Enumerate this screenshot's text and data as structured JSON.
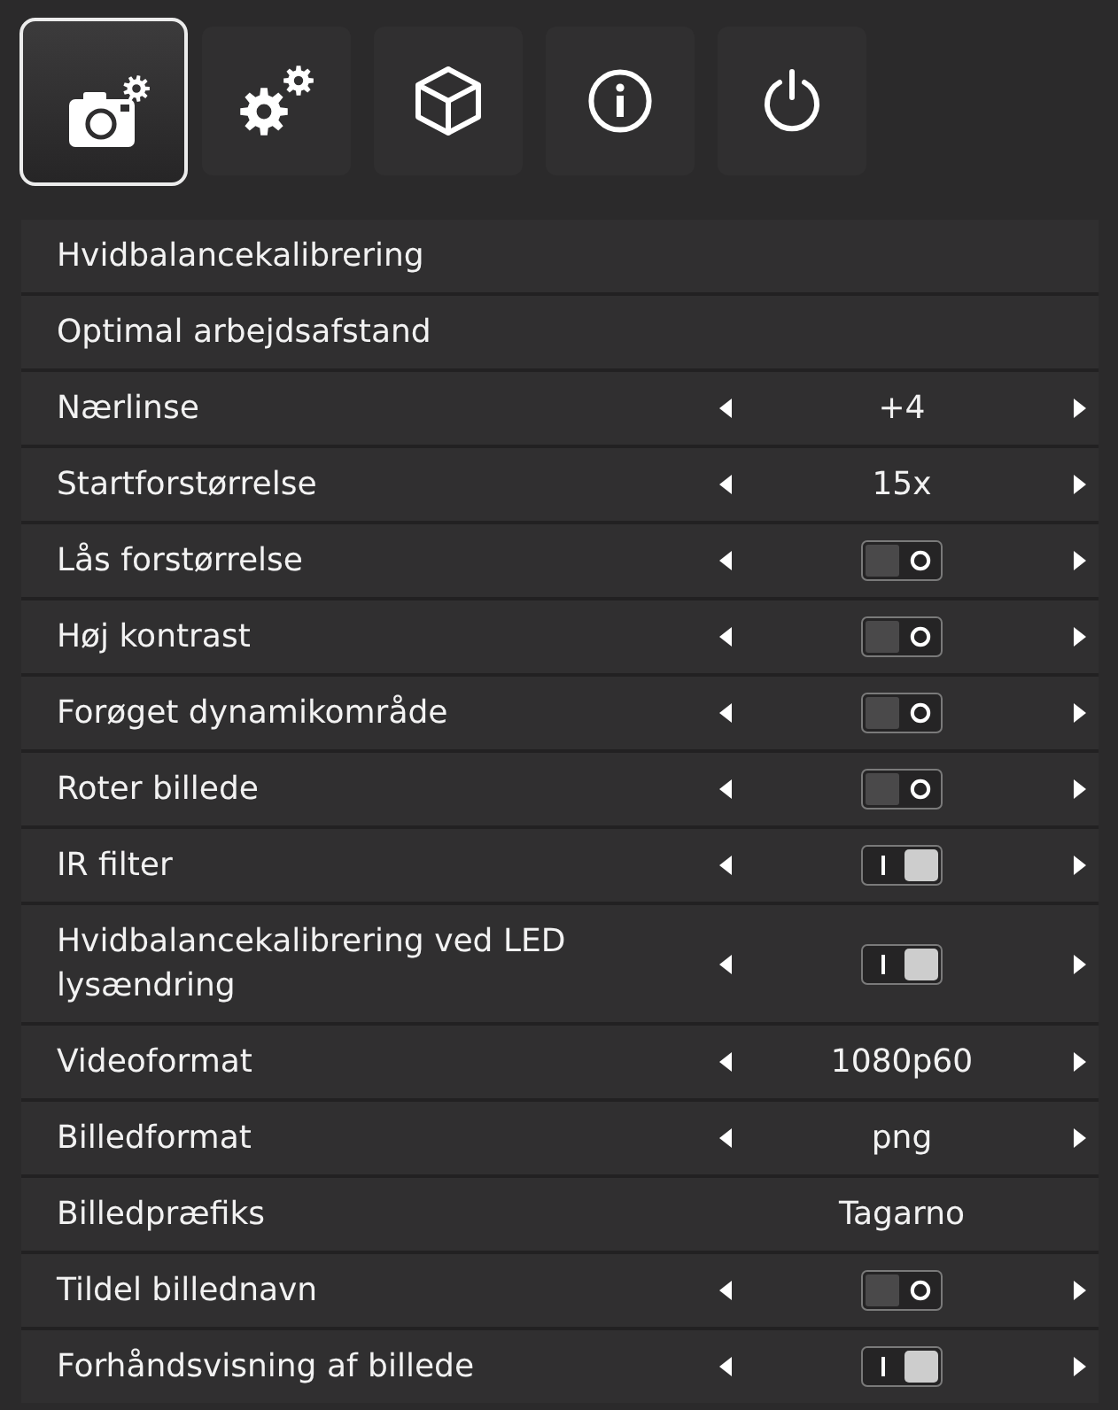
{
  "tabs": [
    {
      "kind": "camera",
      "selected": true
    },
    {
      "kind": "settings",
      "selected": false
    },
    {
      "kind": "cube",
      "selected": false
    },
    {
      "kind": "info",
      "selected": false
    },
    {
      "kind": "power",
      "selected": false
    }
  ],
  "rows": [
    {
      "kind": "action",
      "label": "Hvidbalancekalibrering"
    },
    {
      "kind": "action",
      "label": "Optimal arbejdsafstand"
    },
    {
      "kind": "choice",
      "label": "Nærlinse",
      "value": "+4"
    },
    {
      "kind": "choice",
      "label": "Startforstørrelse",
      "value": "15x"
    },
    {
      "kind": "toggle",
      "label": "Lås forstørrelse",
      "on": false
    },
    {
      "kind": "toggle",
      "label": "Høj kontrast",
      "on": false
    },
    {
      "kind": "toggle",
      "label": "Forøget dynamikområde",
      "on": false
    },
    {
      "kind": "toggle",
      "label": "Roter billede",
      "on": false
    },
    {
      "kind": "toggle",
      "label": "IR filter",
      "on": true
    },
    {
      "kind": "toggle",
      "label": "Hvidbalancekalibrering ved LED lysændring",
      "on": true
    },
    {
      "kind": "choice",
      "label": "Videoformat",
      "value": "1080p60"
    },
    {
      "kind": "choice",
      "label": "Billedformat",
      "value": "png"
    },
    {
      "kind": "text",
      "label": "Billedpræfiks",
      "value": "Tagarno"
    },
    {
      "kind": "toggle",
      "label": "Tildel billednavn",
      "on": false
    },
    {
      "kind": "toggle",
      "label": "Forhåndsvisning af billede",
      "on": true
    }
  ]
}
